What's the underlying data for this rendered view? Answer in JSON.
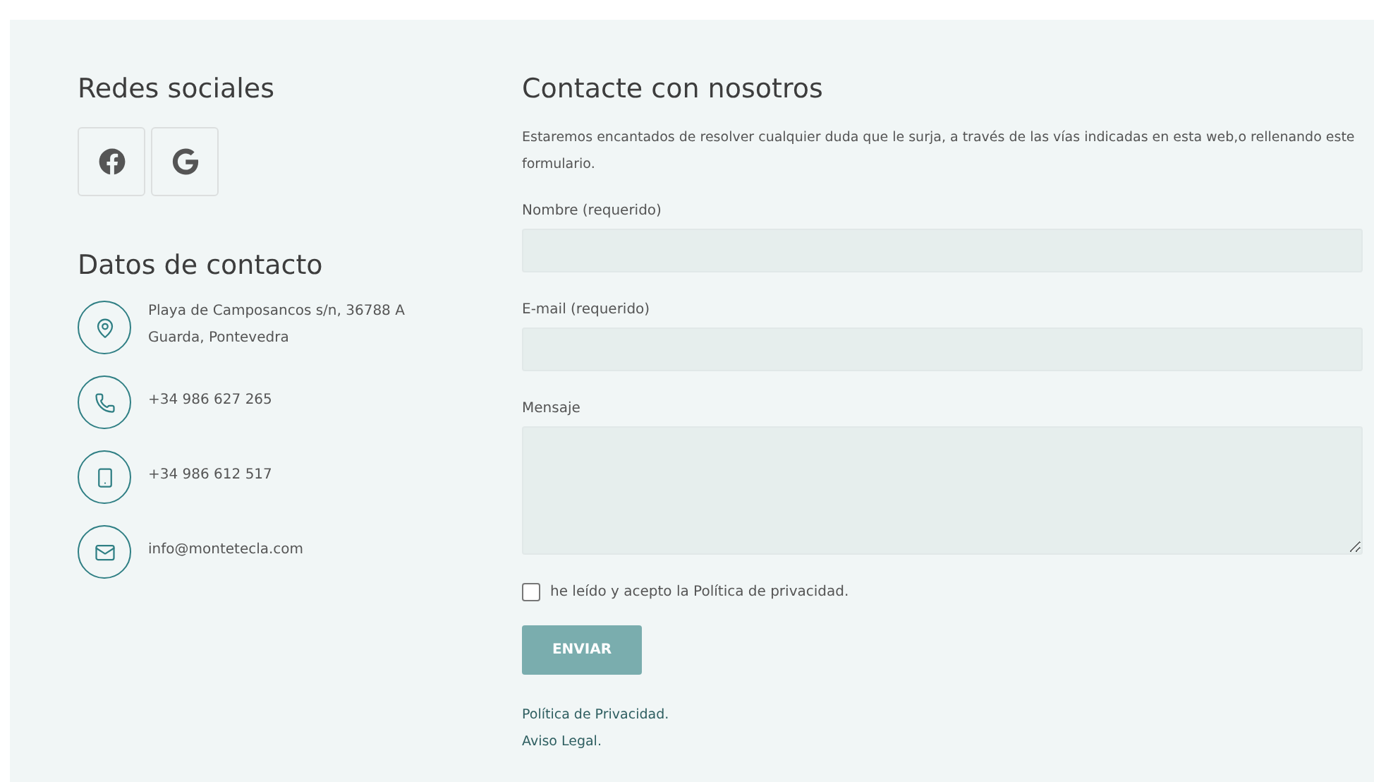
{
  "social": {
    "title": "Redes sociales",
    "buttons": [
      {
        "kind": "facebook"
      },
      {
        "kind": "google"
      }
    ]
  },
  "contact": {
    "title": "Datos de contacto",
    "items": [
      {
        "kind": "location",
        "text": "Playa de Camposancos s/n, 36788 A Guarda, Pontevedra"
      },
      {
        "kind": "phone",
        "text": "+34 986 627 265"
      },
      {
        "kind": "mobile",
        "text": "+34 986 612 517"
      },
      {
        "kind": "email",
        "text": "info@montetecla.com"
      }
    ]
  },
  "form": {
    "title": "Contacte con nosotros",
    "intro": "Estaremos encantados de resolver cualquier duda que le surja, a través de las vías indicadas en esta web,o rellenando este formulario.",
    "fields": [
      {
        "kind": "input",
        "label": "Nombre (requerido)"
      },
      {
        "kind": "input",
        "label": "E-mail (requerido)"
      },
      {
        "kind": "textarea",
        "label": "Mensaje"
      }
    ],
    "consent": {
      "label": "he leído y acepto la Política de privacidad.",
      "checked": false
    },
    "submit": "ENVIAR",
    "links": [
      "Política de Privacidad.",
      "Aviso Legal."
    ]
  }
}
